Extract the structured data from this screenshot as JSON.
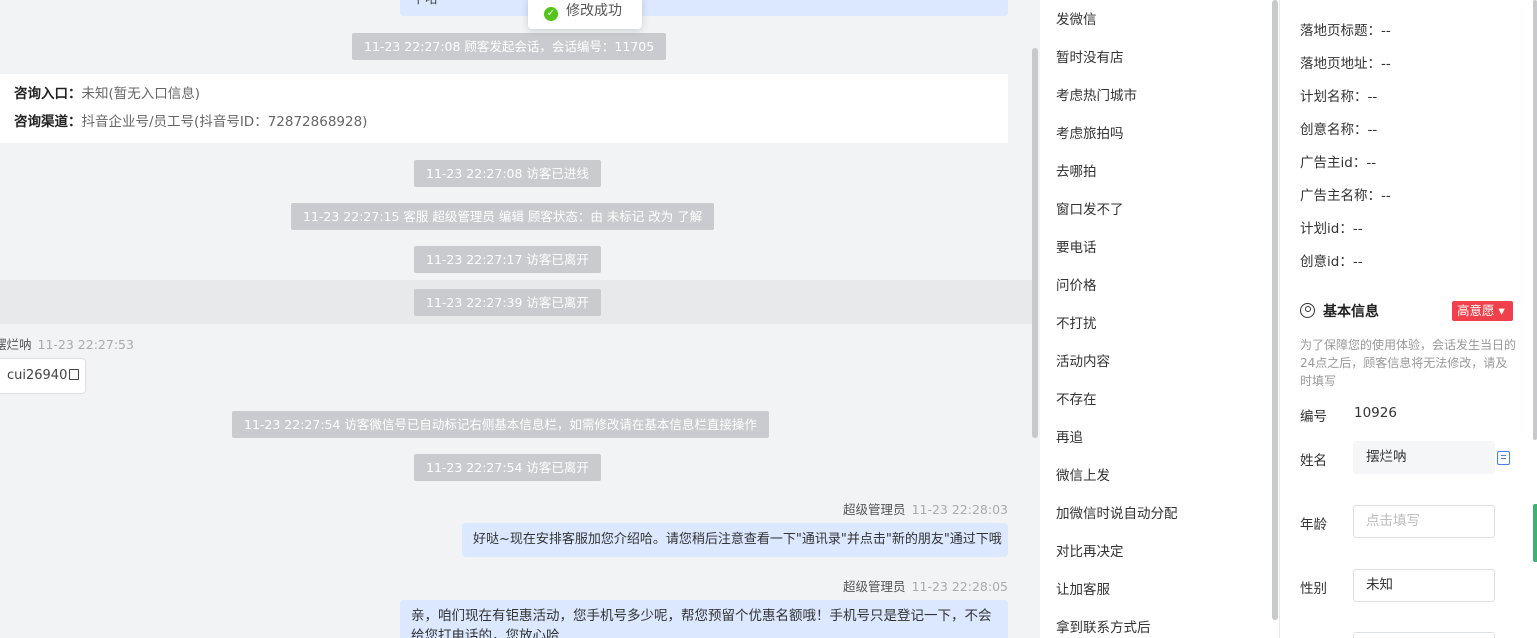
{
  "toast": {
    "text": "修改成功"
  },
  "chat": {
    "top_bubble_text": "下哈",
    "session_start": "11-23 22:27:08 顾客发起会话，会话编号：11705",
    "entry_card": {
      "entry_label": "咨询入口：",
      "entry_value": "未知(暂无入口信息)",
      "channel_label": "咨询渠道：",
      "channel_value": "抖音企业号/员工号(抖音号ID：72872868928)"
    },
    "events": [
      "11-23 22:27:08 访客已进线",
      "11-23 22:27:15 客服 超级管理员 编辑 顾客状态：由 未标记 改为 了解",
      "11-23 22:27:17 访客已离开",
      "11-23 22:27:39 访客已离开"
    ],
    "visitor_msg": {
      "name": "摆烂呐",
      "time": "11-23 22:27:53",
      "wechat": "cui26940"
    },
    "auto_mark": "11-23 22:27:54 访客微信号已自动标记右侧基本信息栏，如需修改请在基本信息栏直接操作",
    "left_event": "11-23 22:27:54 访客已离开",
    "agent_msgs": [
      {
        "name": "超级管理员",
        "time": "11-23 22:28:03",
        "text": "好哒~现在安排客服加您介绍哈。请您稍后注意查看一下\"通讯录\"并点击\"新的朋友\"通过下哦"
      },
      {
        "name": "超级管理员",
        "time": "11-23 22:28:05",
        "text": "亲，咱们现在有钜惠活动，您手机号多少呢，帮您预留个优惠名额哦！手机号只是登记一下，不会给您打电话的，您放心哈"
      }
    ]
  },
  "quick_replies": [
    "发微信",
    "暂时没有店",
    "考虑热门城市",
    "考虑旅拍吗",
    "去哪拍",
    "窗口发不了",
    "要电话",
    "问价格",
    "不打扰",
    "活动内容",
    "不存在",
    "再追",
    "微信上发",
    "加微信时说自动分配",
    "对比再决定",
    "让加客服",
    "拿到联系方式后"
  ],
  "info": {
    "source_rows": [
      "落地页标题：--",
      "落地页地址：--",
      "计划名称：--",
      "创意名称：--",
      "广告主id：--",
      "广告主名称：--",
      "计划id：--",
      "创意id：--"
    ],
    "basic_title": "基本信息",
    "intent_badge": "高意愿 ▾",
    "notice": "为了保障您的使用体验，会话发生当日的24点之后，顾客信息将无法修改，请及时填写",
    "id_label": "编号",
    "id_value": "10926",
    "name_label": "姓名",
    "name_value": "摆烂呐",
    "age_label": "年龄",
    "age_placeholder": "点击填写",
    "gender_label": "性别",
    "gender_value": "未知"
  },
  "colors": {
    "accent": "#4a7df0",
    "intent": "#f0404b",
    "bubble": "#dbe8ff",
    "system": "#c9cbcf"
  }
}
